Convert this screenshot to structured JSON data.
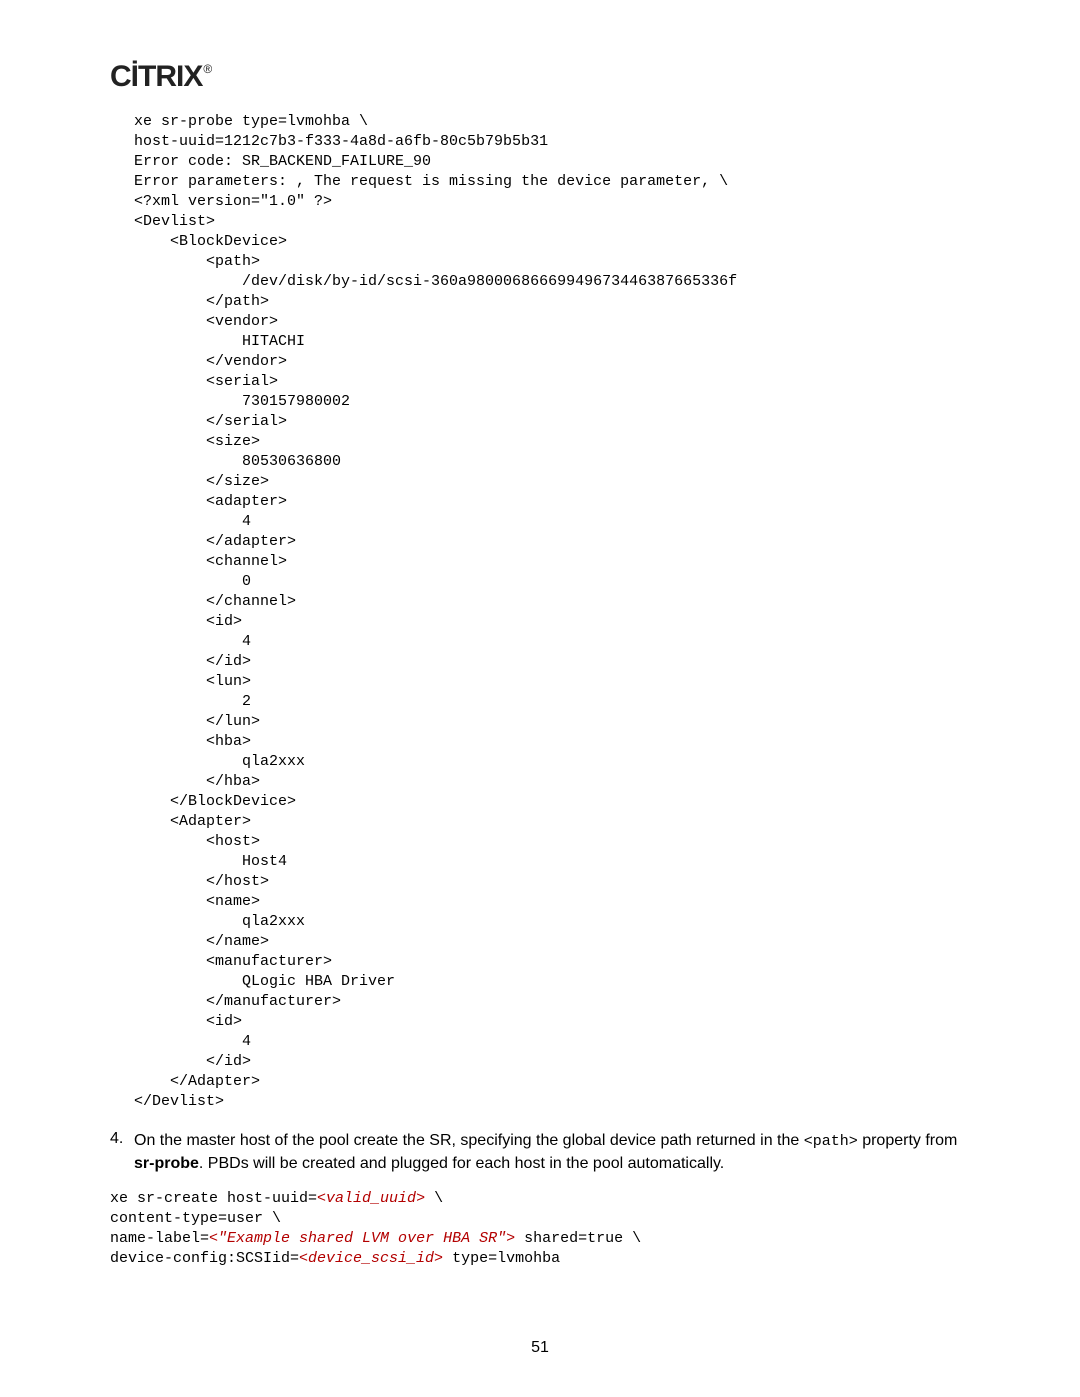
{
  "logo": {
    "text": "CİTRIX",
    "mark": "®"
  },
  "code1": "xe sr-probe type=lvmohba \\\nhost-uuid=1212c7b3-f333-4a8d-a6fb-80c5b79b5b31\nError code: SR_BACKEND_FAILURE_90\nError parameters: , The request is missing the device parameter, \\\n<?xml version=\"1.0\" ?>\n<Devlist>\n    <BlockDevice>\n        <path>\n            /dev/disk/by-id/scsi-360a98000686669949673446387665336f\n        </path>\n        <vendor>\n            HITACHI\n        </vendor>\n        <serial>\n            730157980002\n        </serial>\n        <size>\n            80530636800\n        </size>\n        <adapter>\n            4\n        </adapter>\n        <channel>\n            0\n        </channel>\n        <id>\n            4\n        </id>\n        <lun>\n            2\n        </lun>\n        <hba>\n            qla2xxx\n        </hba>\n    </BlockDevice>\n    <Adapter>\n        <host>\n            Host4\n        </host>\n        <name>\n            qla2xxx\n        </name>\n        <manufacturer>\n            QLogic HBA Driver\n        </manufacturer>\n        <id>\n            4\n        </id>\n    </Adapter>\n</Devlist>",
  "step4": {
    "num": "4.",
    "part1": "On the master host of the pool create the SR, specifying the global device path returned in the ",
    "path_tag": "<path>",
    "part2": " property from ",
    "bold": "sr-probe",
    "part3": ". PBDs will be created and plugged for each host in the pool automatically."
  },
  "code2": {
    "l1a": "xe sr-create host-uuid=",
    "l1b": "<valid_uuid>",
    "l1c": " \\",
    "l2": "content-type=user \\",
    "l3a": "name-label=",
    "l3b": "<\"Example shared LVM over HBA SR\">",
    "l3c": " shared=true \\",
    "l4a": "device-config:SCSIid=",
    "l4b": "<device_scsi_id>",
    "l4c": " type=lvmohba"
  },
  "page_number": "51"
}
